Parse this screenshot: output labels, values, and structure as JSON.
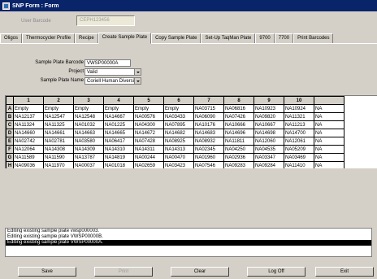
{
  "window": {
    "title": "SNP Form : Form"
  },
  "user_bar": {
    "label": "User Barcode",
    "value": "CEPH123456"
  },
  "tabs": [
    {
      "label": "Oligos"
    },
    {
      "label": "Thermocycler Profile"
    },
    {
      "label": "Recipe"
    },
    {
      "label": "Create Sample Plate",
      "active": true
    },
    {
      "label": "Copy Sample Plate"
    },
    {
      "label": "Set-Up TaqMan Plate"
    },
    {
      "label": "9700"
    },
    {
      "label": "7700"
    },
    {
      "label": "Print Barcodes"
    }
  ],
  "form": {
    "barcode_label": "Sample Plate Barcode",
    "barcode_value": "VWSP00000A",
    "project_label": "Project",
    "project_value": "Valid",
    "name_label": "Sample Plate Name",
    "name_value": "Coriell Human Diversity"
  },
  "grid": {
    "columns": [
      "1",
      "2",
      "3",
      "4",
      "5",
      "6",
      "7",
      "8",
      "9",
      "10",
      ""
    ],
    "rows": [
      {
        "label": "A",
        "cells": [
          "Empty",
          "Empty",
          "Empty",
          "Empty",
          "Empty",
          "Empty",
          "NA03715",
          "NA06816",
          "NA10923",
          "NA10924",
          "NA"
        ]
      },
      {
        "label": "B",
        "cells": [
          "NA12137",
          "NA12547",
          "NA12548",
          "NA14667",
          "NA00576",
          "NA03433",
          "NA06090",
          "NA07426",
          "NA09820",
          "NA11321",
          "NA"
        ]
      },
      {
        "label": "C",
        "cells": [
          "NA11324",
          "NA11325",
          "NA01032",
          "NA01225",
          "NA04300",
          "NA07895",
          "NA10176",
          "NA10666",
          "NA10667",
          "NA11213",
          "NA"
        ]
      },
      {
        "label": "D",
        "cells": [
          "NA14660",
          "NA14661",
          "NA14663",
          "NA14665",
          "NA14672",
          "NA14682",
          "NA14683",
          "NA14696",
          "NA14698",
          "NA14700",
          "NA"
        ]
      },
      {
        "label": "E",
        "cells": [
          "NA02742",
          "NA02781",
          "NA03580",
          "NA06417",
          "NA07428",
          "NA08925",
          "NA08932",
          "NA11811",
          "NA12060",
          "NA12061",
          "NA"
        ]
      },
      {
        "label": "F",
        "cells": [
          "NA12064",
          "NA14308",
          "NA14309",
          "NA14310",
          "NA14311",
          "NA14313",
          "NA02345",
          "NA04250",
          "NA04535",
          "NA05209",
          "NA"
        ]
      },
      {
        "label": "G",
        "cells": [
          "NA11589",
          "NA11590",
          "NA13787",
          "NA14819",
          "NA00244",
          "NA00470",
          "NA01960",
          "NA02936",
          "NA03347",
          "NA03469",
          "NA"
        ]
      },
      {
        "label": "H",
        "cells": [
          "NA09036",
          "NA11970",
          "NA00037",
          "NA01018",
          "NA02659",
          "NA03423",
          "NA07546",
          "NA09283",
          "NA09284",
          "NA11410",
          "NA"
        ]
      }
    ]
  },
  "log": [
    {
      "text": "Editing existing sample plate vwsp000003."
    },
    {
      "text": "Editing existing sample plate VWSP00000B."
    },
    {
      "text": "Editing existing sample plate VWSP00000A.",
      "selected": true
    }
  ],
  "buttons": {
    "save": "Save",
    "print": "Print",
    "clear": "Clear",
    "logoff": "Log Off",
    "exit": "Exit"
  }
}
